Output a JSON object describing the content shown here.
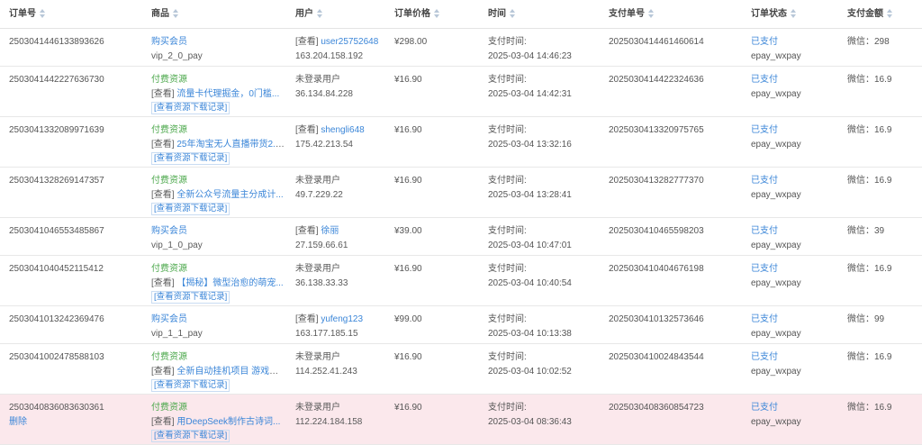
{
  "headers": {
    "order_no": "订单号",
    "product": "商品",
    "user": "用户",
    "price": "订单价格",
    "time": "时间",
    "pay_no": "支付单号",
    "status": "订单状态",
    "amount": "支付金额"
  },
  "labels": {
    "view": "[查看]",
    "view_records": "[查看资源下载记录]",
    "pay_time": "支付时间:",
    "delete": "删除"
  },
  "rows": [
    {
      "order_no": "2503041446133893626",
      "product_type": "购买会员",
      "product_name": "vip_2_0_pay",
      "user_link": "user25752648",
      "user_guest": "",
      "ip": "163.204.158.192",
      "price": "¥298.00",
      "time": "2025-03-04 14:46:23",
      "pay_no": "2025030414461460614",
      "status": "已支付",
      "method": "epay_wxpay",
      "amount": "微信：298",
      "highlight": false
    },
    {
      "order_no": "2503041442227636730",
      "product_type": "付费资源",
      "product_name": "流量卡代理掘金，0门槛...",
      "user_link": "",
      "user_guest": "未登录用户",
      "ip": "36.134.84.228",
      "price": "¥16.90",
      "time": "2025-03-04 14:42:31",
      "pay_no": "2025030414422324636",
      "status": "已支付",
      "method": "epay_wxpay",
      "amount": "微信：16.9",
      "highlight": false
    },
    {
      "order_no": "2503041332089971639",
      "product_type": "付费资源",
      "product_name": "25年淘宝无人直播带货2.0...",
      "user_link": "shengli648",
      "user_guest": "",
      "ip": "175.42.213.54",
      "price": "¥16.90",
      "time": "2025-03-04 13:32:16",
      "pay_no": "2025030413320975765",
      "status": "已支付",
      "method": "epay_wxpay",
      "amount": "微信：16.9",
      "highlight": false
    },
    {
      "order_no": "2503041328269147357",
      "product_type": "付费资源",
      "product_name": "全新公众号流量主分成计...",
      "user_link": "",
      "user_guest": "未登录用户",
      "ip": "49.7.229.22",
      "price": "¥16.90",
      "time": "2025-03-04 13:28:41",
      "pay_no": "2025030413282777370",
      "status": "已支付",
      "method": "epay_wxpay",
      "amount": "微信：16.9",
      "highlight": false
    },
    {
      "order_no": "2503041046553485867",
      "product_type": "购买会员",
      "product_name": "vip_1_0_pay",
      "user_link": "徐丽",
      "user_guest": "",
      "ip": "27.159.66.61",
      "price": "¥39.00",
      "time": "2025-03-04 10:47:01",
      "pay_no": "2025030410465598203",
      "status": "已支付",
      "method": "epay_wxpay",
      "amount": "微信：39",
      "highlight": false
    },
    {
      "order_no": "2503041040452115412",
      "product_type": "付费资源",
      "product_name": "【揭秘】微型治愈的萌宠...",
      "user_link": "",
      "user_guest": "未登录用户",
      "ip": "36.138.33.33",
      "price": "¥16.90",
      "time": "2025-03-04 10:40:54",
      "pay_no": "2025030410404676198",
      "status": "已支付",
      "method": "epay_wxpay",
      "amount": "微信：16.9",
      "highlight": false
    },
    {
      "order_no": "2503041013242369476",
      "product_type": "购买会员",
      "product_name": "vip_1_1_pay",
      "user_link": "yufeng123",
      "user_guest": "",
      "ip": "163.177.185.15",
      "price": "¥99.00",
      "time": "2025-03-04 10:13:38",
      "pay_no": "2025030410132573646",
      "status": "已支付",
      "method": "epay_wxpay",
      "amount": "微信：99",
      "highlight": false
    },
    {
      "order_no": "2503041002478588103",
      "product_type": "付费资源",
      "product_name": "全新自动挂机项目 游戏打...",
      "user_link": "",
      "user_guest": "未登录用户",
      "ip": "114.252.41.243",
      "price": "¥16.90",
      "time": "2025-03-04 10:02:52",
      "pay_no": "2025030410024843544",
      "status": "已支付",
      "method": "epay_wxpay",
      "amount": "微信：16.9",
      "highlight": false
    },
    {
      "order_no": "2503040836083630361",
      "product_type": "付费资源",
      "product_name": "用DeepSeek制作古诗词...",
      "user_link": "",
      "user_guest": "未登录用户",
      "ip": "112.224.184.158",
      "price": "¥16.90",
      "time": "2025-03-04 08:36:43",
      "pay_no": "2025030408360854723",
      "status": "已支付",
      "method": "epay_wxpay",
      "amount": "微信：16.9",
      "highlight": true
    }
  ],
  "colors": {
    "link": "#3b86d8",
    "green": "#4aa74a",
    "highlight": "#fbe8ec"
  }
}
